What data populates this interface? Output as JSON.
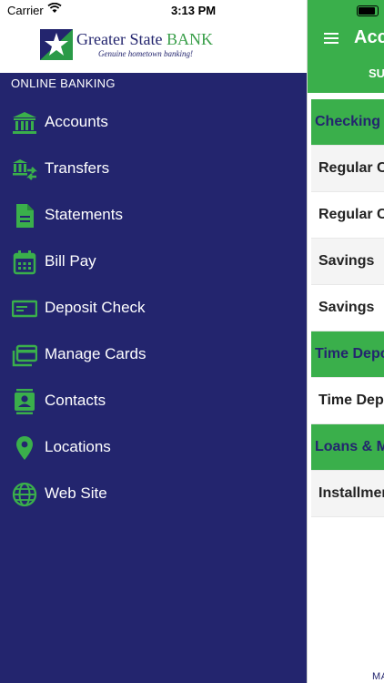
{
  "status_bar": {
    "carrier": "Carrier",
    "time": "3:13 PM"
  },
  "brand": {
    "name_main": "Greater State",
    "name_accent": "BANK",
    "tagline": "Genuine hometown banking!"
  },
  "menu": {
    "section_title": "ONLINE BANKING",
    "items": [
      {
        "label": "Accounts",
        "icon": "bank-icon"
      },
      {
        "label": "Transfers",
        "icon": "transfer-icon"
      },
      {
        "label": "Statements",
        "icon": "document-icon"
      },
      {
        "label": "Bill Pay",
        "icon": "calendar-icon"
      },
      {
        "label": "Deposit Check",
        "icon": "check-icon"
      },
      {
        "label": "Manage Cards",
        "icon": "cards-icon"
      },
      {
        "label": "Contacts",
        "icon": "contact-icon"
      },
      {
        "label": "Locations",
        "icon": "location-pin-icon"
      },
      {
        "label": "Web Site",
        "icon": "globe-icon"
      }
    ]
  },
  "background_screen": {
    "title": "Acc",
    "tab": "SU",
    "rows": [
      {
        "kind": "header",
        "text": "Checking"
      },
      {
        "kind": "item",
        "text": "Regular C"
      },
      {
        "kind": "item",
        "text": "Regular C"
      },
      {
        "kind": "item",
        "text": "Savings"
      },
      {
        "kind": "item",
        "text": "Savings"
      },
      {
        "kind": "header",
        "text": "Time Depo"
      },
      {
        "kind": "item",
        "text": "Time Dep"
      },
      {
        "kind": "header",
        "text": "Loans & M"
      },
      {
        "kind": "item",
        "text": "Installmen"
      }
    ],
    "footer_tab": "MA"
  },
  "colors": {
    "menu_bg": "#23256e",
    "accent_green": "#3aaf4b",
    "icon_green": "#3aaf4b"
  }
}
